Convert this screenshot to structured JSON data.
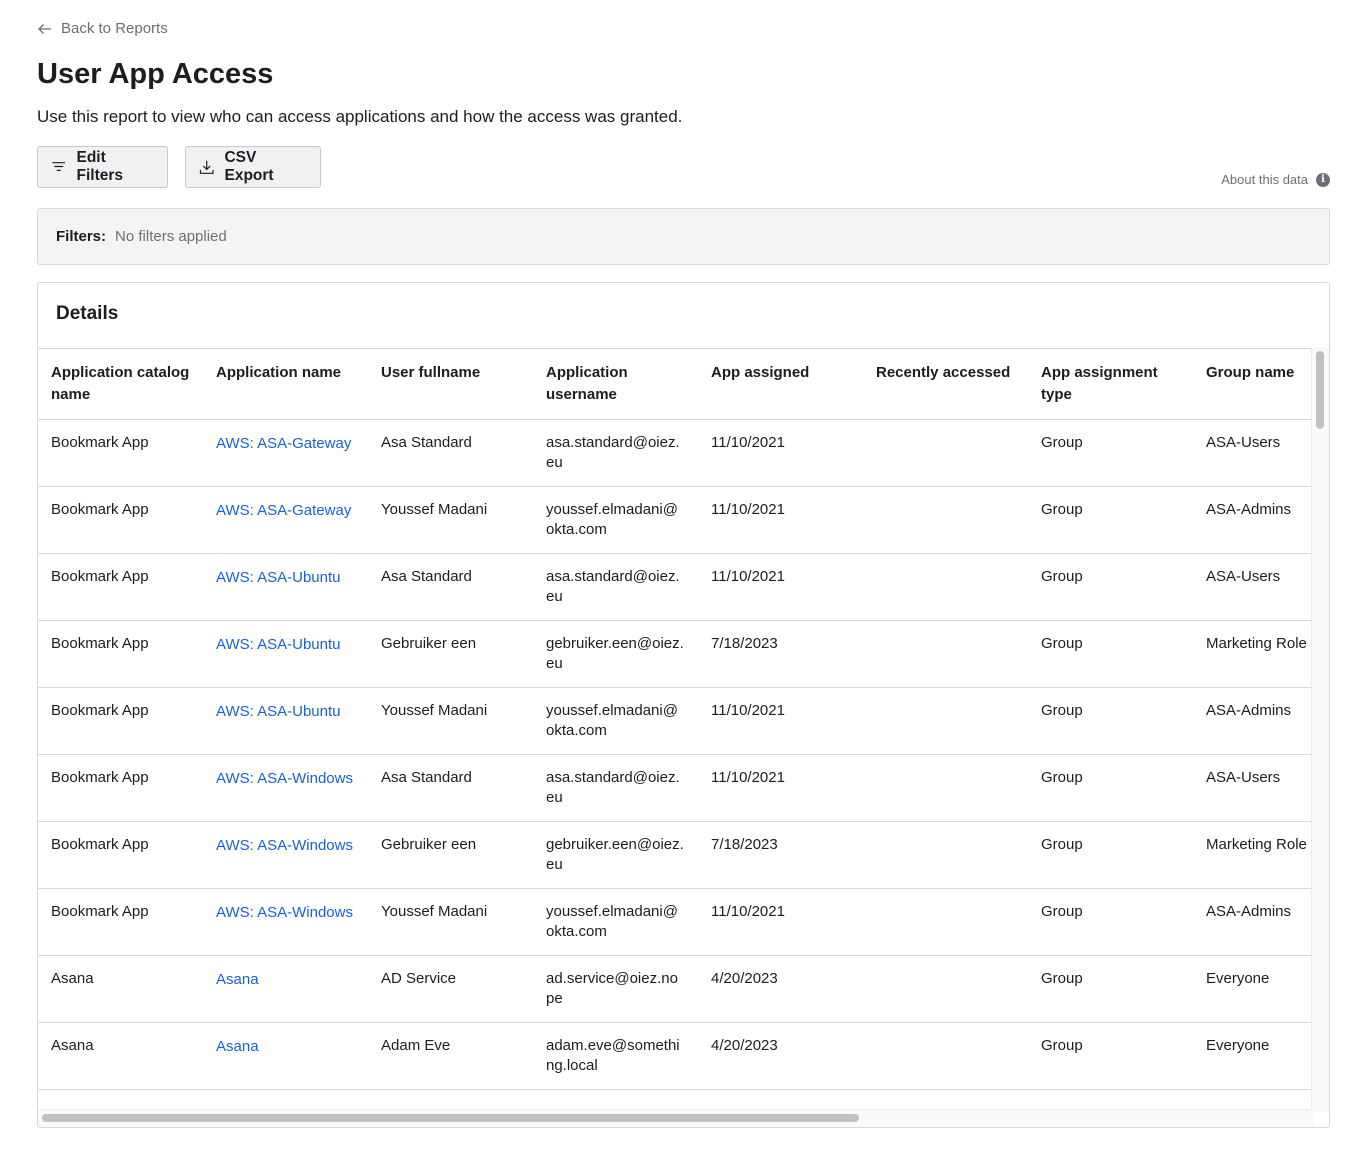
{
  "nav": {
    "back_label": "Back to Reports"
  },
  "page": {
    "title": "User App Access",
    "description": "Use this report to view who can access applications and how the access was granted."
  },
  "toolbar": {
    "edit_filters_label": "Edit Filters",
    "csv_export_label": "CSV Export",
    "about_label": "About this data"
  },
  "filters": {
    "label": "Filters:",
    "value": "No filters applied"
  },
  "details": {
    "title": "Details",
    "columns": [
      "Application catalog name",
      "Application name",
      "User fullname",
      "Application username",
      "App assigned",
      "Recently accessed",
      "App assignment type",
      "Group name"
    ],
    "rows": [
      [
        "Bookmark App",
        "AWS: ASA-Gateway",
        "Asa Standard",
        "asa.standard@oiez.eu",
        "11/10/2021",
        "",
        "Group",
        "ASA-Users"
      ],
      [
        "Bookmark App",
        "AWS: ASA-Gateway",
        "Youssef Madani",
        "youssef.elmadani@okta.com",
        "11/10/2021",
        "",
        "Group",
        "ASA-Admins"
      ],
      [
        "Bookmark App",
        "AWS: ASA-Ubuntu",
        "Asa Standard",
        "asa.standard@oiez.eu",
        "11/10/2021",
        "",
        "Group",
        "ASA-Users"
      ],
      [
        "Bookmark App",
        "AWS: ASA-Ubuntu",
        "Gebruiker een",
        "gebruiker.een@oiez.eu",
        "7/18/2023",
        "",
        "Group",
        "Marketing Role"
      ],
      [
        "Bookmark App",
        "AWS: ASA-Ubuntu",
        "Youssef Madani",
        "youssef.elmadani@okta.com",
        "11/10/2021",
        "",
        "Group",
        "ASA-Admins"
      ],
      [
        "Bookmark App",
        "AWS: ASA-Windows",
        "Asa Standard",
        "asa.standard@oiez.eu",
        "11/10/2021",
        "",
        "Group",
        "ASA-Users"
      ],
      [
        "Bookmark App",
        "AWS: ASA-Windows",
        "Gebruiker een",
        "gebruiker.een@oiez.eu",
        "7/18/2023",
        "",
        "Group",
        "Marketing Role"
      ],
      [
        "Bookmark App",
        "AWS: ASA-Windows",
        "Youssef Madani",
        "youssef.elmadani@okta.com",
        "11/10/2021",
        "",
        "Group",
        "ASA-Admins"
      ],
      [
        "Asana",
        "Asana",
        "AD Service",
        "ad.service@oiez.nope",
        "4/20/2023",
        "",
        "Group",
        "Everyone"
      ],
      [
        "Asana",
        "Asana",
        "Adam Eve",
        "adam.eve@something.local",
        "4/20/2023",
        "",
        "Group",
        "Everyone"
      ]
    ]
  },
  "colors": {
    "link": "#1662dd",
    "muted": "#6e6e78",
    "border": "#d7d7dc"
  }
}
